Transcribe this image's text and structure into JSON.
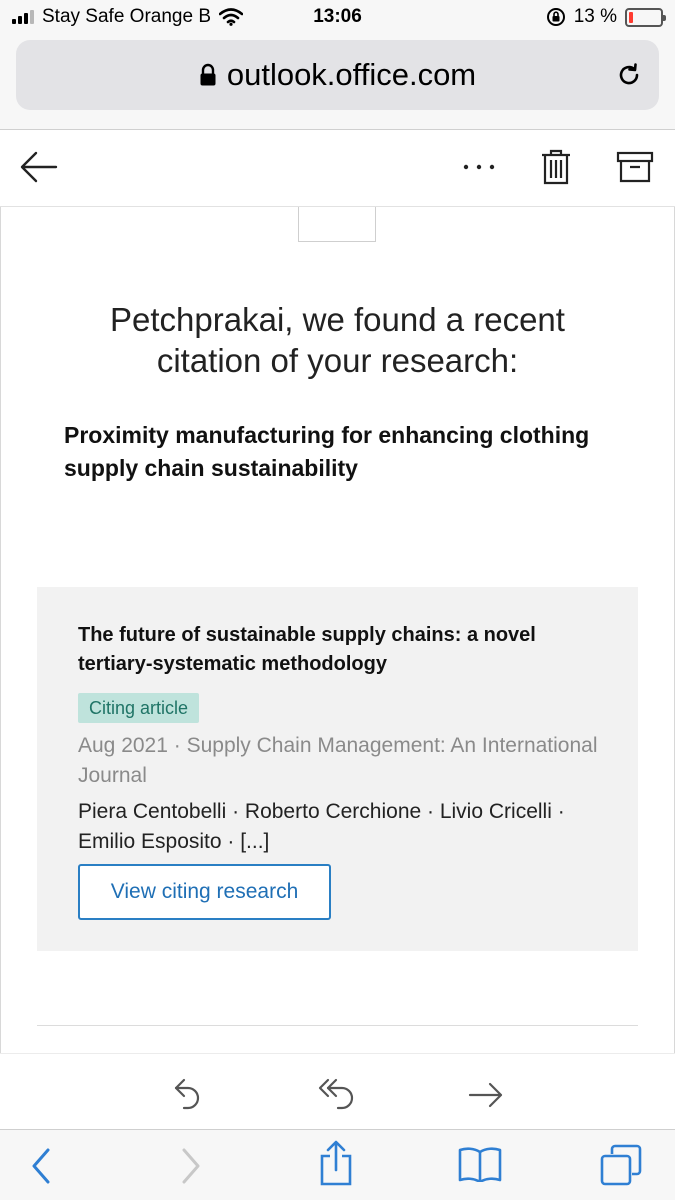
{
  "status_bar": {
    "carrier": "Stay Safe Orange B",
    "time": "13:06",
    "battery_percent": "13 %",
    "battery_level": 0.13,
    "battery_color": "#ff3b30",
    "icons": [
      "signal-icon",
      "wifi-icon",
      "orientation-lock-icon",
      "battery-icon"
    ]
  },
  "address_bar": {
    "url": "outlook.office.com",
    "icons": [
      "lock-icon",
      "reload-icon"
    ]
  },
  "mail_toolbar": {
    "icons": [
      "back-arrow-icon",
      "more-options-icon",
      "delete-icon",
      "archive-icon"
    ]
  },
  "email": {
    "headline": "Petchprakai, we found a recent citation of your research:",
    "paper_title": "Proximity manufacturing for enhancing clothing supply chain sustainability",
    "citing": {
      "title": "The future of sustainable supply chains: a novel tertiary-systematic methodology",
      "badge": "Citing article",
      "meta": "Aug 2021 · Supply Chain Management: An International Journal",
      "authors": "Piera Centobelli · Roberto Cerchione · Livio Cricelli · Emilio Esposito · [...]",
      "button_label": "View citing research"
    }
  },
  "reply_bar": {
    "icons": [
      "reply-icon",
      "reply-all-icon",
      "forward-icon"
    ]
  },
  "safari_toolbar": {
    "icons": [
      "browser-back-icon",
      "browser-forward-icon",
      "share-icon",
      "bookmarks-icon",
      "tabs-icon"
    ]
  },
  "colors": {
    "accent_blue": "#1f6fb5",
    "ios_blue": "#2f7fd3",
    "badge_bg": "#bfe3dc",
    "badge_text": "#1f7466",
    "card_bg": "#f2f2f2"
  }
}
